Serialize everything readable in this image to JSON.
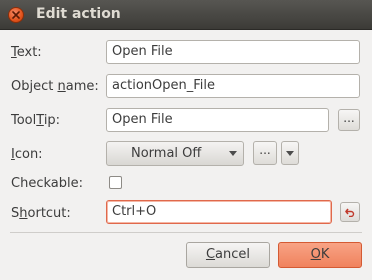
{
  "window": {
    "title": "Edit action"
  },
  "form": {
    "text_label": "Text:",
    "text_value": "Open File",
    "object_name_label": "Object name:",
    "object_name_value": "actionOpen_File",
    "tooltip_label": "ToolTip:",
    "tooltip_value": "Open File",
    "tooltip_browse": "...",
    "icon_label": "Icon:",
    "icon_mode": "Normal Off",
    "icon_browse": "...",
    "checkable_label": "Checkable:",
    "checkable_checked": false,
    "shortcut_label": "Shortcut:",
    "shortcut_value": "Ctrl+O"
  },
  "buttons": {
    "cancel": "Cancel",
    "ok": "OK"
  },
  "colors": {
    "titlebar": "#3c3b37",
    "accent": "#f0825d",
    "focus_border": "#e0684b",
    "close": "#e2531c"
  },
  "icons": {
    "close": "close-icon",
    "combo_arrow": "chevron-down-icon",
    "reset": "undo-arrow-icon"
  }
}
